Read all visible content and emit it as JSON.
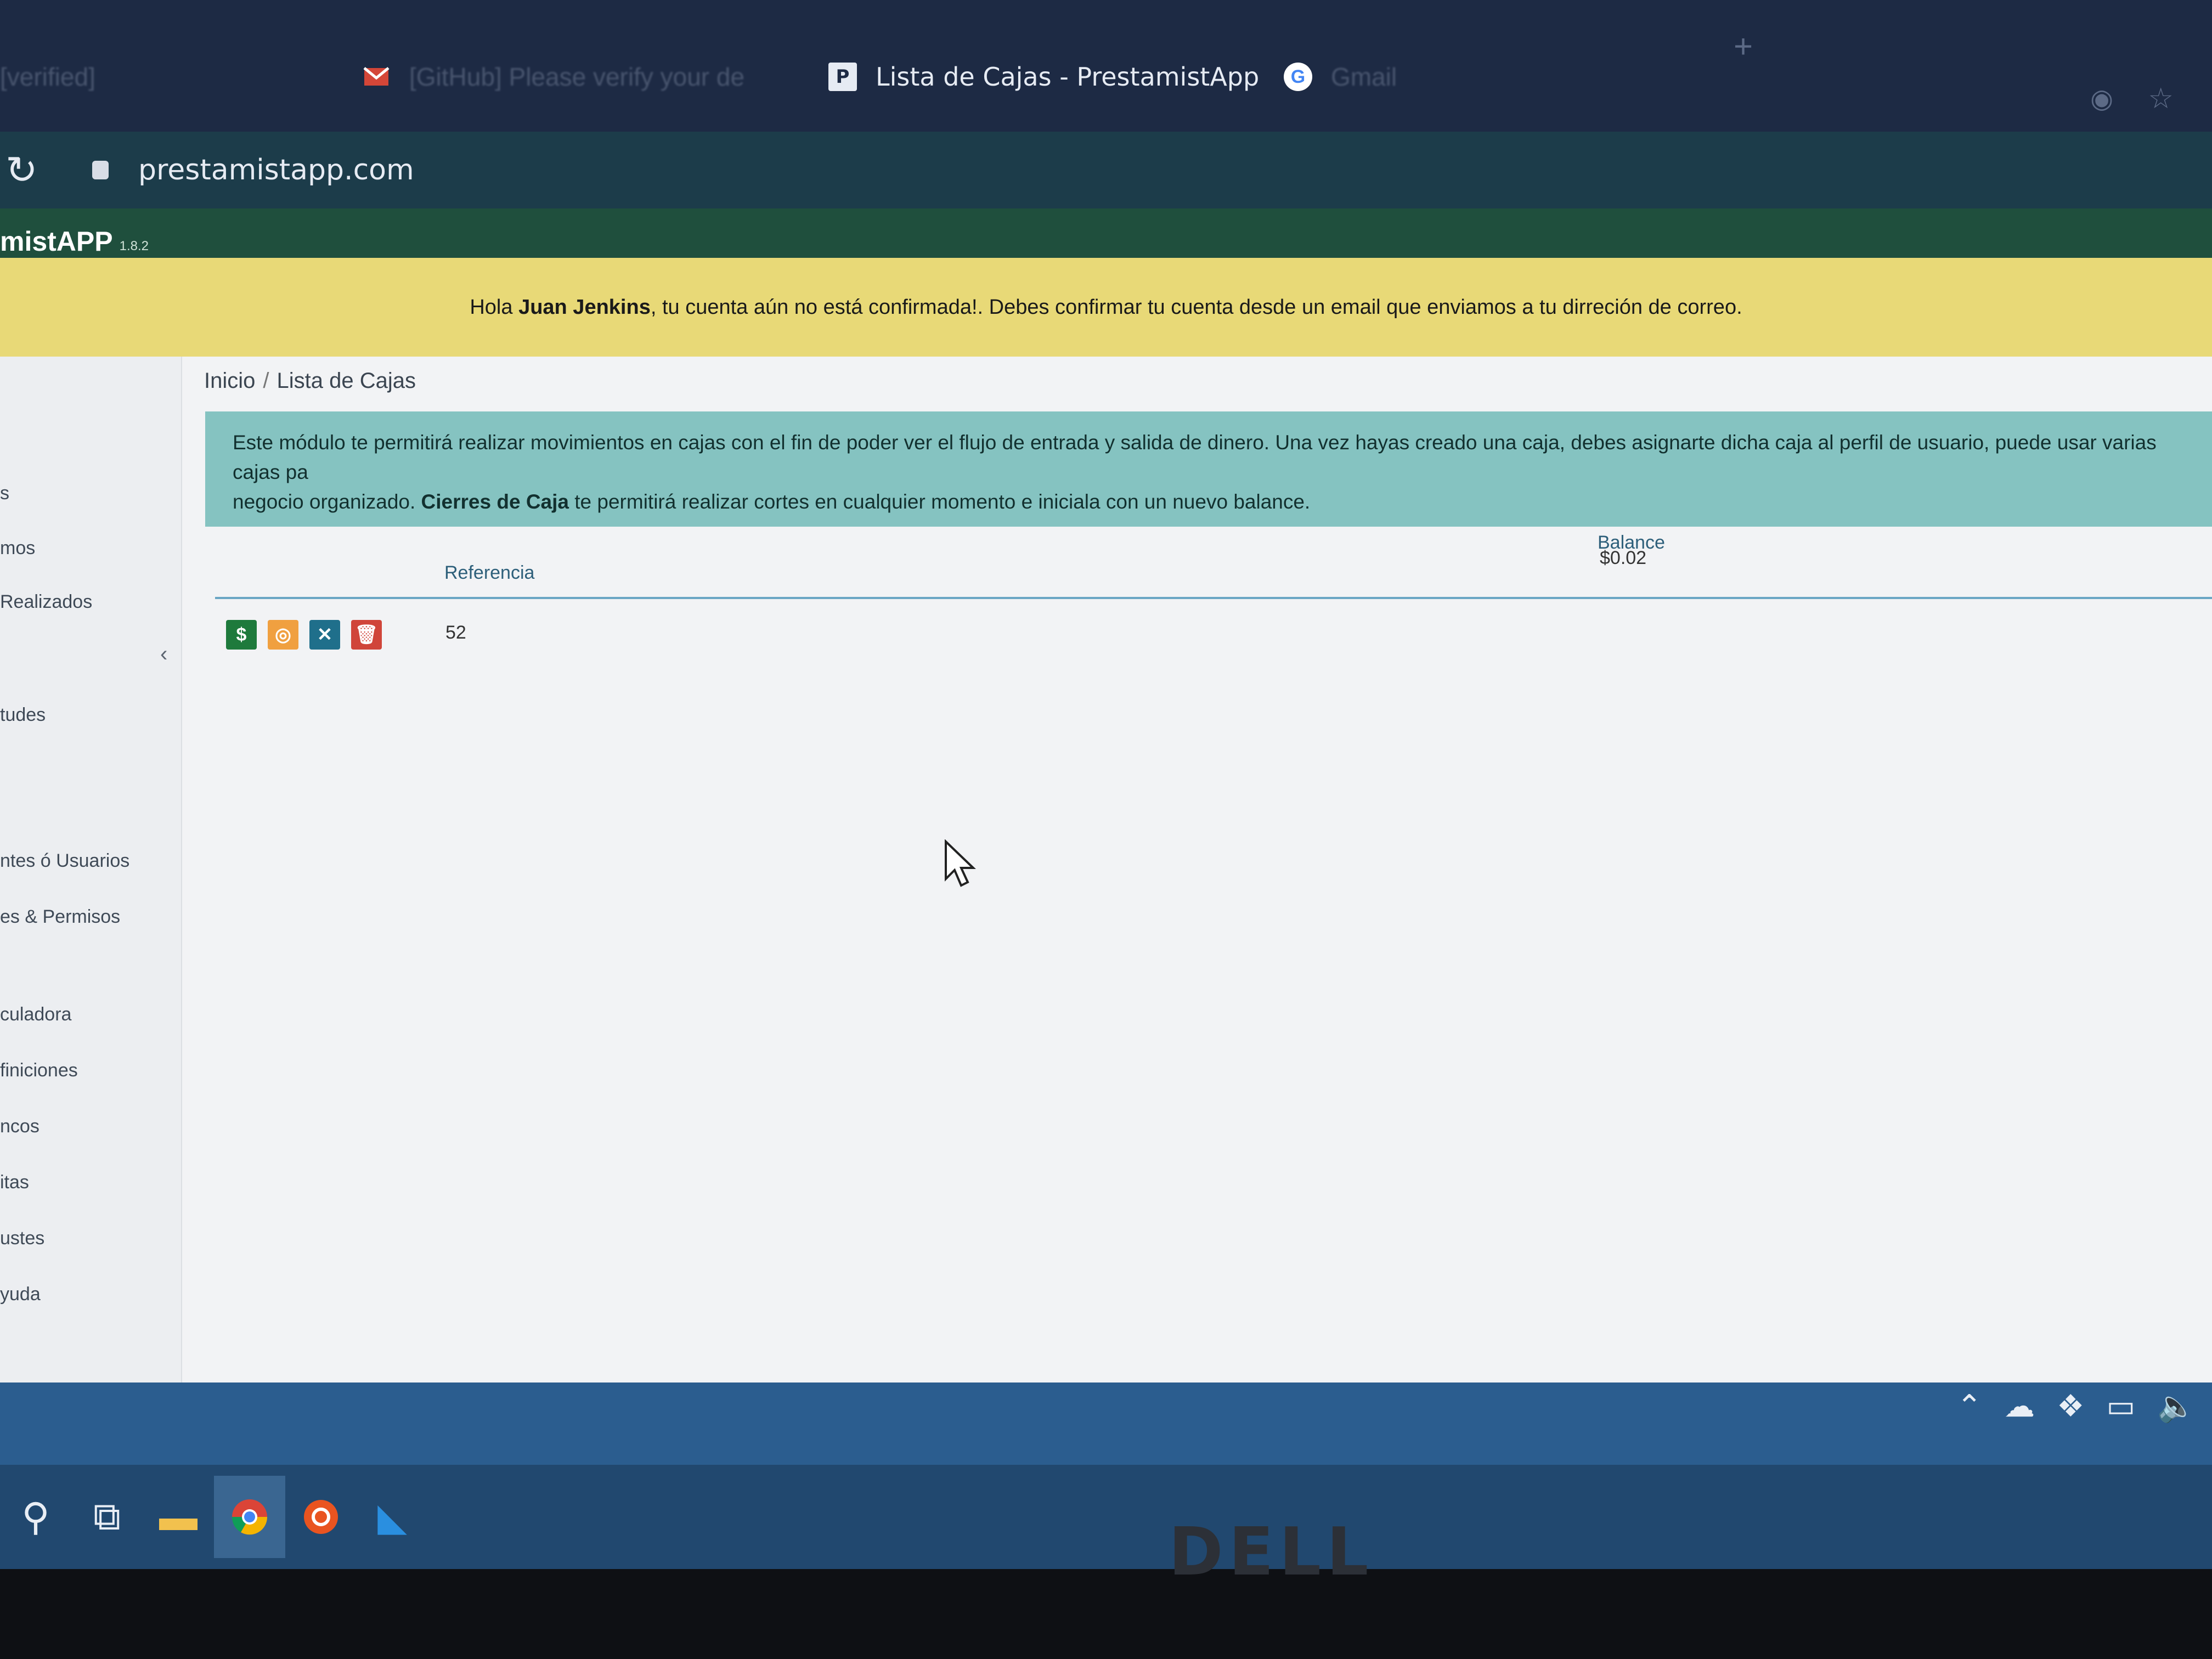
{
  "browser": {
    "tabs": [
      {
        "label": "[verified]",
        "faded": true
      },
      {
        "label": "[GitHub] Please verify your de",
        "faded": true,
        "icon": "gmail-icon"
      },
      {
        "label": "Lista de Cajas - PrestamistApp",
        "active": true,
        "icon": "prestamistapp-favicon"
      },
      {
        "label": "Gmail",
        "faded": true,
        "icon": "google-icon"
      }
    ],
    "new_tab": "+",
    "url": "prestamistapp.com"
  },
  "app": {
    "brand": "mistAPP",
    "version": "1.8.2"
  },
  "alert": {
    "prefix": "Hola",
    "name": "Juan Jenkins",
    "message": ", tu cuenta aún no está confirmada!. Debes confirmar tu cuenta desde un email que enviamos a tu dirreción de correo."
  },
  "sidebar": {
    "items": [
      "s",
      "mos",
      "Realizados",
      "tudes",
      "ntes ó Usuarios",
      "es & Permisos",
      "culadora",
      "finiciones",
      "ncos",
      "itas",
      "ustes",
      "yuda"
    ],
    "collapse": "‹"
  },
  "breadcrumb": {
    "home": "Inicio",
    "separator": "/",
    "current": "Lista de Cajas"
  },
  "info": {
    "text1": "Este módulo te permitirá realizar movimientos en cajas con el fin de poder ver el flujo de entrada y salida de dinero. Una vez hayas creado una caja, debes asignarte dicha caja al perfil de usuario, puede usar varias cajas pa",
    "text2": "negocio organizado.",
    "bold": "Cierres de Caja",
    "text3": "te permitirá realizar cortes en cualquier momento e iniciala con un nuevo balance."
  },
  "table": {
    "columns": {
      "referencia": "Referencia",
      "balance": "Balance"
    },
    "rows": [
      {
        "referencia": "52",
        "balance": "$0.02"
      }
    ],
    "actions": [
      {
        "name": "money-button",
        "icon": "$",
        "color": "#1e7a3c"
      },
      {
        "name": "view-button",
        "icon": "◎",
        "color": "#f0a040"
      },
      {
        "name": "close-box-button",
        "icon": "✕",
        "color": "#1f6f8b"
      },
      {
        "name": "delete-button",
        "icon": "🗑",
        "color": "#d0453a"
      }
    ]
  },
  "taskbar": {
    "icons": [
      "search-icon",
      "task-view-icon",
      "file-explorer-icon",
      "chrome-icon",
      "ubuntu-icon",
      "vscode-icon"
    ]
  },
  "monitor_brand": "DELL"
}
